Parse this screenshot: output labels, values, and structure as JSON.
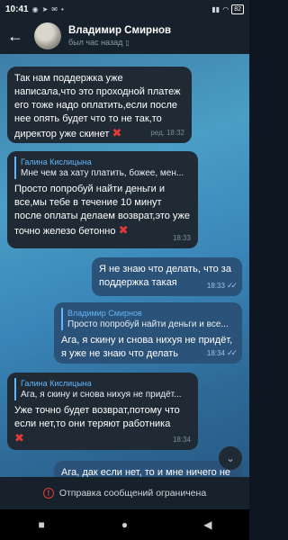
{
  "status_bar": {
    "time": "10:41",
    "battery": "82"
  },
  "header": {
    "contact_name": "Владимир Смирнов",
    "last_seen": "был час назад"
  },
  "messages": [
    {
      "type": "in",
      "text": "Так нам поддержка уже написала,что это проходной платеж его тоже надо оплатить,если после нее опять будет что то не так,то директор уже скинет",
      "edited_label": "ред.",
      "time": "18:32"
    },
    {
      "type": "in",
      "quote_name": "Галина Кислицына",
      "quote_text": "Мне чем за хату платить, божее, мен...",
      "text": "Просто попробуй найти деньги и все,мы тебе в течение 10 минут после оплаты делаем возврат,это уже точно железо бетонно",
      "time": "18:33"
    },
    {
      "type": "out",
      "text": "Я не знаю что делать, что за поддержка такая",
      "time": "18:33"
    },
    {
      "type": "out",
      "quote_name": "Владимир Смирнов",
      "quote_text": "Просто попробуй найти деньги и все...",
      "text": "Ага, я скину и снова нихуя не придёт, я уже не знаю что делать",
      "time": "18:34"
    },
    {
      "type": "in",
      "quote_name": "Галина Кислицына",
      "quote_text": "Ага, я скину и снова нихуя не придёт...",
      "text": "Уже точно будет возврат,потому что если нет,то они теряют работника",
      "time": "18:34"
    },
    {
      "type": "out",
      "text": "Ага, дак если нет, то и мне ничего не"
    }
  ],
  "restricted_bar": {
    "text": "Отправка сообщений ограничена"
  },
  "icons": {
    "back": "back-arrow-icon",
    "cross": "red-cross-mark",
    "scroll": "chevron-down-icon"
  },
  "colors": {
    "header_bg": "#17212b",
    "incoming_bubble": "#1f2a35",
    "outgoing_bubble": "#2b5278",
    "quote_accent": "#64b5f6",
    "warning_red": "#e53935"
  }
}
